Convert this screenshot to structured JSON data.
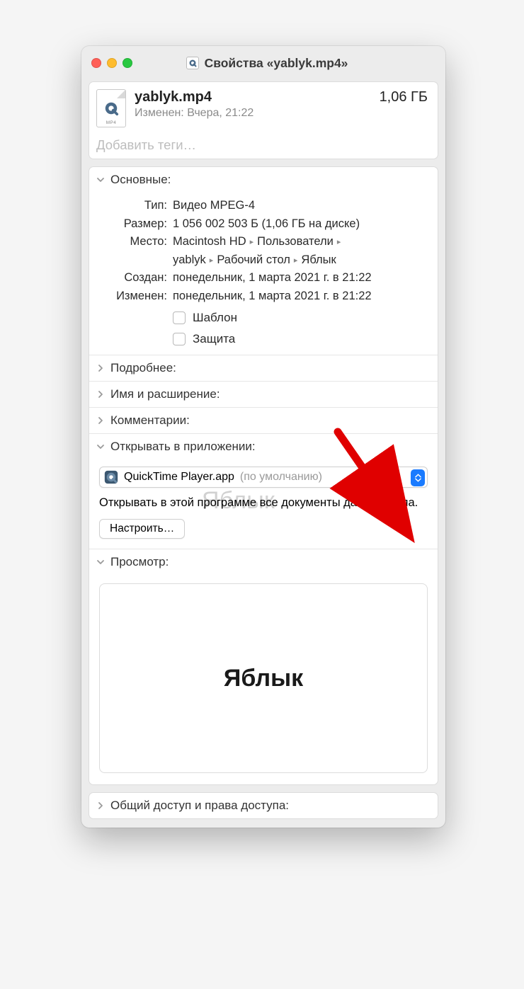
{
  "title": "Свойства «yablyk.mp4»",
  "file": {
    "name": "yablyk.mp4",
    "size": "1,06 ГБ",
    "modified_short": "Изменен: Вчера, 21:22",
    "ext_badge": "MP4"
  },
  "tags_placeholder": "Добавить теги…",
  "sections": {
    "general": "Основные:",
    "more": "Подробнее:",
    "name_ext": "Имя и расширение:",
    "comments": "Комментарии:",
    "open_with": "Открывать в приложении:",
    "preview": "Просмотр:",
    "sharing": "Общий доступ и права доступа:"
  },
  "general": {
    "labels": {
      "kind": "Тип:",
      "size": "Размер:",
      "where": "Место:",
      "created": "Создан:",
      "modified": "Изменен:"
    },
    "kind": "Видео MPEG-4",
    "size": "1 056 002 503 Б (1,06 ГБ на диске)",
    "where_parts": [
      "Macintosh HD",
      "Пользователи",
      "yablyk",
      "Рабочий стол",
      "Яблык"
    ],
    "created": "понедельник, 1 марта 2021 г. в 21:22",
    "modified": "понедельник, 1 марта 2021 г. в 21:22",
    "checkbox_template": "Шаблон",
    "checkbox_locked": "Защита"
  },
  "open_with": {
    "app": "QuickTime Player.app",
    "default_suffix": "(по умолчанию)",
    "description": "Открывать в этой программе все документы данного типа.",
    "change_all": "Настроить…"
  },
  "preview": {
    "content": "Яблык"
  },
  "watermark": "Яблык"
}
